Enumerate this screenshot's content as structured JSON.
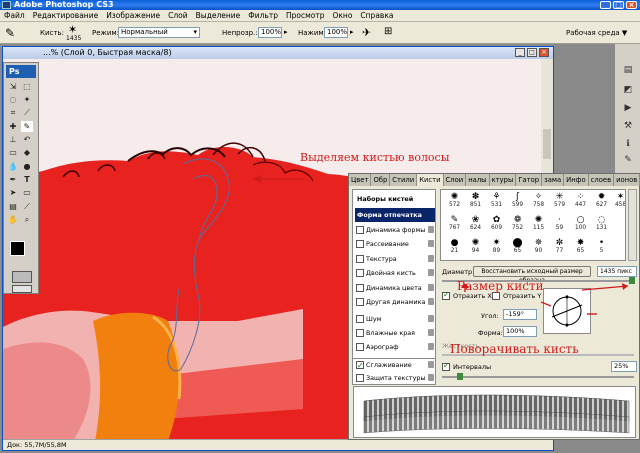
{
  "app": {
    "title": "Adobe Photoshop CS3",
    "logo": "Ps"
  },
  "menu": [
    "Файл",
    "Редактирование",
    "Изображение",
    "Слой",
    "Выделение",
    "Фильтр",
    "Просмотр",
    "Окно",
    "Справка"
  ],
  "options": {
    "brush_label": "Кисть:",
    "brush_size": "1435",
    "mode_label": "Режим:",
    "mode_value": "Нормальный",
    "opacity_label": "Непрозр.:",
    "opacity_value": "100%",
    "flow_label": "Нажим:",
    "flow_value": "100%",
    "workspace_label": "Рабочая среда ▼"
  },
  "document": {
    "title": "...% (Слой 0, Быстрая маска/8)",
    "status": "Док: 55,7M/55,8M"
  },
  "annotations": {
    "select_hair": "Выделяем кистью волосы",
    "brush_size": "Размер кисти",
    "rotate_brush": "Поворачивать кисть"
  },
  "panel": {
    "tabs": [
      "Цвет",
      "Обр",
      "Стили",
      "Кисти",
      "Слои",
      "налы",
      "ктуры",
      "Гатор",
      "зама",
      "Инфо",
      "слоев",
      "ионов"
    ],
    "active_tab": "Кисти",
    "list": [
      {
        "label": "Наборы кистей",
        "type": "head"
      },
      {
        "label": "Форма отпечатка кисти",
        "type": "selected"
      },
      {
        "label": "Динамика формы",
        "checked": false
      },
      {
        "label": "Рассеивание",
        "checked": false
      },
      {
        "label": "Текстура",
        "checked": false
      },
      {
        "label": "Двойная кисть",
        "checked": false
      },
      {
        "label": "Динамика цвета",
        "checked": false
      },
      {
        "label": "Другая динамика",
        "checked": false
      },
      {
        "label": "Шум",
        "checked": false
      },
      {
        "label": "Влажные края",
        "checked": false
      },
      {
        "label": "Аэрограф",
        "checked": false
      },
      {
        "label": "Сглаживание",
        "checked": true
      },
      {
        "label": "Защита текстуры",
        "checked": false
      }
    ],
    "tips_row1": [
      "572",
      "851",
      "531",
      "599",
      "758",
      "579",
      "447",
      "627",
      "458"
    ],
    "tips_row2": [
      "767",
      "624",
      "609",
      "752",
      "115",
      "59",
      "100",
      "131"
    ],
    "tips_row3": [
      "21",
      "94",
      "89",
      "65",
      "90",
      "77",
      "65",
      "5"
    ],
    "diameter_label": "Диаметр",
    "restore_button": "Восстановить исходный размер образца",
    "diameter_value": "1435 пикс",
    "flip_x": "Отразить X",
    "flip_y": "Отразить Y",
    "angle_label": "Угол:",
    "angle_value": "-159°",
    "roundness_label": "Форма:",
    "roundness_value": "100%",
    "hardness_label": "Жесткость",
    "spacing_label": "Интервалы",
    "spacing_value": "25%"
  }
}
